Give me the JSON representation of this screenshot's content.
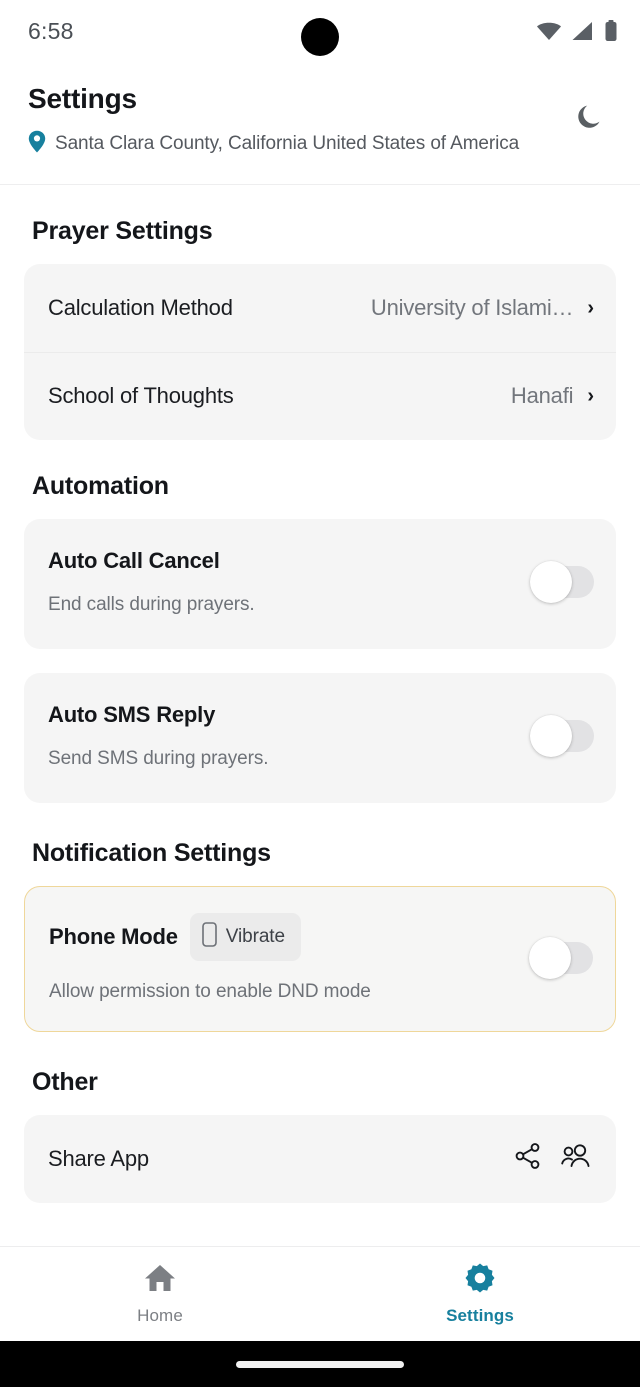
{
  "status_bar": {
    "time": "6:58",
    "icons": [
      "wifi-icon",
      "cellular-signal-icon",
      "battery-icon"
    ]
  },
  "header": {
    "title": "Settings",
    "location": "Santa Clara County, California United States of America",
    "location_icon": "location-pin-icon",
    "theme_toggle_icon": "moon-icon"
  },
  "colors": {
    "accent": "#17809e",
    "card_bg": "#f5f5f5",
    "highlight_border": "#efd79a",
    "text_primary": "#14161a",
    "text_secondary": "#6e7278"
  },
  "sections": {
    "prayer_settings": {
      "title": "Prayer Settings",
      "rows": [
        {
          "label": "Calculation Method",
          "value": "University of Islami…",
          "chevron": "›"
        },
        {
          "label": "School of Thoughts",
          "value": "Hanafi",
          "chevron": "›"
        }
      ]
    },
    "automation": {
      "title": "Automation",
      "items": [
        {
          "title": "Auto Call Cancel",
          "subtitle": "End calls during prayers.",
          "toggle_state": "off"
        },
        {
          "title": "Auto SMS Reply",
          "subtitle": "Send SMS during prayers.",
          "toggle_state": "off"
        }
      ]
    },
    "notification_settings": {
      "title": "Notification Settings",
      "phone_mode": {
        "label": "Phone Mode",
        "chip_label": "Vibrate",
        "chip_icon": "phone-vibrate-icon",
        "subtitle": "Allow permission to enable DND mode",
        "toggle_state": "off"
      }
    },
    "other": {
      "title": "Other",
      "share_app": {
        "label": "Share App",
        "icons": [
          "share-nodes-icon",
          "people-group-icon"
        ]
      }
    }
  },
  "bottom_nav": {
    "items": [
      {
        "label": "Home",
        "icon": "home-icon",
        "active": false
      },
      {
        "label": "Settings",
        "icon": "gear-icon",
        "active": true
      }
    ]
  }
}
